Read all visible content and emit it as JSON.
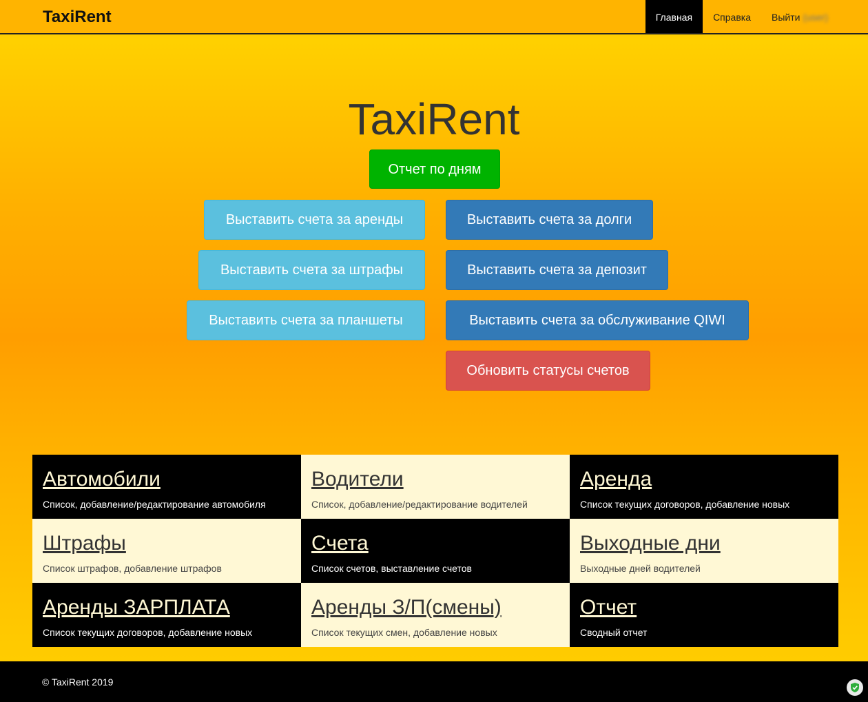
{
  "navbar": {
    "brand": "TaxiRent",
    "links": [
      {
        "label": "Главная",
        "active": true
      },
      {
        "label": "Справка"
      },
      {
        "label": "Выйти"
      }
    ],
    "user_name_blurred": "(user)"
  },
  "hero": {
    "title": "TaxiRent",
    "report_button": "Отчет по дням"
  },
  "actions": {
    "left": [
      "Выставить счета за аренды",
      "Выставить счета за штрафы",
      "Выставить счета за планшеты"
    ],
    "right": [
      "Выставить счета за долги",
      "Выставить счета за депозит",
      "Выставить счета за обслуживание QIWI"
    ],
    "refresh": "Обновить статусы счетов"
  },
  "tiles": [
    {
      "title": "Автомобили",
      "desc": "Список, добавление/редактирование автомобиля"
    },
    {
      "title": "Водители",
      "desc": "Список, добавление/редактирование водителей"
    },
    {
      "title": "Аренда",
      "desc": "Список текущих договоров, добавление новых"
    },
    {
      "title": "Штрафы",
      "desc": "Список штрафов, добавление штрафов"
    },
    {
      "title": "Счета",
      "desc": "Список счетов, выставление счетов"
    },
    {
      "title": "Выходные дни",
      "desc": "Выходные дней водителей"
    },
    {
      "title": "Аренды ЗАРПЛАТА",
      "desc": "Список текущих договоров, добавление новых"
    },
    {
      "title": "Аренды З/П(смены)",
      "desc": "Список текущих смен, добавление новых"
    },
    {
      "title": "Отчет",
      "desc": "Сводный отчет"
    }
  ],
  "footer": {
    "copyright": "© TaxiRent 2019"
  },
  "colors": {
    "accent_yellow": "#ffb400",
    "green": "#00b300",
    "info": "#5bc0de",
    "primary": "#337ab7",
    "danger": "#d9534f",
    "tile_light": "#fff8d5"
  },
  "icons": {
    "extension_badge": "shield-check-icon"
  }
}
